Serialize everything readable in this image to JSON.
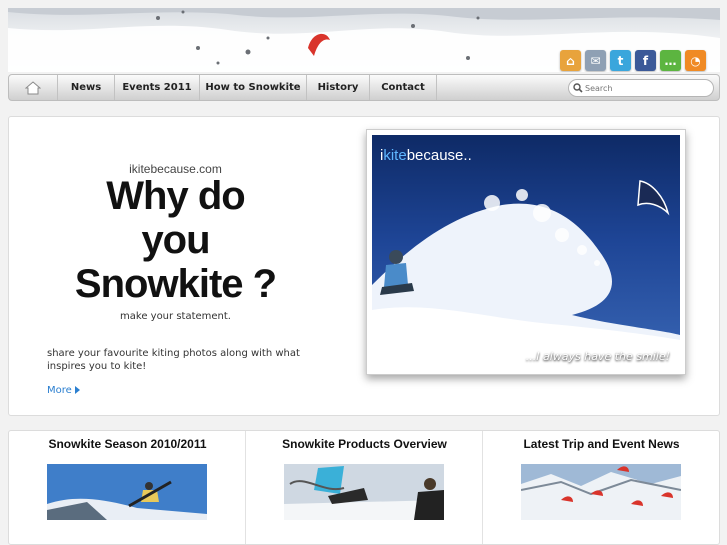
{
  "social": {
    "icons": [
      {
        "name": "home-feed-icon",
        "color": "#e8a33c",
        "glyph": "⌂"
      },
      {
        "name": "mail-icon",
        "color": "#9aa8b8",
        "glyph": "✉"
      },
      {
        "name": "twitter-icon",
        "color": "#3aa6dc",
        "glyph": "t"
      },
      {
        "name": "facebook-icon",
        "color": "#3b5998",
        "glyph": "f"
      },
      {
        "name": "chat-icon",
        "color": "#5cb540",
        "glyph": "…"
      },
      {
        "name": "rss-icon",
        "color": "#f08a24",
        "glyph": "◔"
      }
    ]
  },
  "nav": {
    "home_icon": "home-icon",
    "items": [
      "News",
      "Events 2011",
      "How to Snowkite",
      "History",
      "Contact"
    ]
  },
  "search": {
    "placeholder": "Search"
  },
  "hero": {
    "brand": "ikitebecause.com",
    "headline": [
      "Why do",
      "you",
      "Snowkite ?"
    ],
    "sub": "make your statement.",
    "desc": "share your favourite kiting photos along with what inspires you to kite!",
    "more": "More",
    "photo_logo_a": "i",
    "photo_logo_b": "kite",
    "photo_logo_c": "because..",
    "photo_tag": "...I always have the smile!"
  },
  "columns": [
    {
      "title": "Snowkite Season 2010/2011"
    },
    {
      "title": "Snowkite Products Overview"
    },
    {
      "title": "Latest Trip and Event News"
    }
  ],
  "colors": {
    "accent_link": "#2b7fd0",
    "kite_red": "#d9342b"
  }
}
